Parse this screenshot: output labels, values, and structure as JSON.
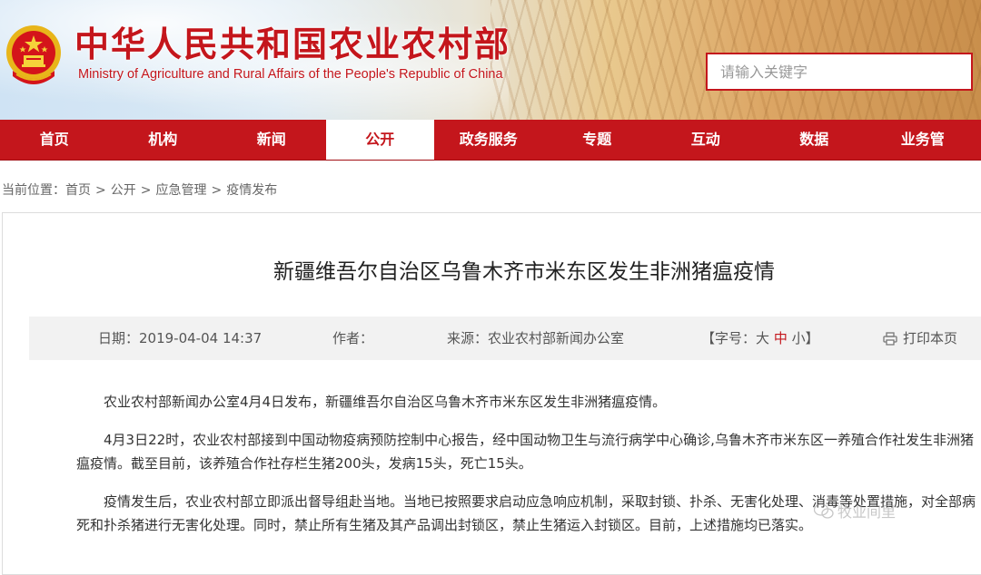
{
  "site": {
    "title": "中华人民共和国农业农村部",
    "subtitle": "Ministry of Agriculture and Rural Affairs of the People's Republic of China"
  },
  "search": {
    "placeholder": "请输入关键字"
  },
  "nav": {
    "items": [
      {
        "label": "首页"
      },
      {
        "label": "机构"
      },
      {
        "label": "新闻"
      },
      {
        "label": "公开"
      },
      {
        "label": "政务服务"
      },
      {
        "label": "专题"
      },
      {
        "label": "互动"
      },
      {
        "label": "数据"
      },
      {
        "label": "业务管"
      }
    ],
    "active_index": 3
  },
  "breadcrumb": {
    "prefix": "当前位置：",
    "items": [
      "首页",
      "公开",
      "应急管理",
      "疫情发布"
    ],
    "separator": ">"
  },
  "article": {
    "title": "新疆维吾尔自治区乌鲁木齐市米东区发生非洲猪瘟疫情",
    "meta": {
      "date": "日期：2019-04-04 14:37",
      "author": "作者：",
      "source": "来源：农业农村部新闻办公室",
      "fontsize_prefix": "【字号：",
      "fontsize_large": "大",
      "fontsize_medium": "中",
      "fontsize_small": "小",
      "fontsize_suffix": "】",
      "print": "打印本页"
    },
    "paragraphs": [
      "农业农村部新闻办公室4月4日发布，新疆维吾尔自治区乌鲁木齐市米东区发生非洲猪瘟疫情。",
      "4月3日22时，农业农村部接到中国动物疫病预防控制中心报告，经中国动物卫生与流行病学中心确诊,乌鲁木齐市米东区一养殖合作社发生非洲猪瘟疫情。截至目前，该养殖合作社存栏生猪200头，发病15头，死亡15头。",
      "疫情发生后，农业农村部立即派出督导组赴当地。当地已按照要求启动应急响应机制，采取封锁、扑杀、无害化处理、消毒等处置措施，对全部病死和扑杀猪进行无害化处理。同时，禁止所有生猪及其产品调出封锁区，禁止生猪运入封锁区。目前，上述措施均已落实。"
    ]
  },
  "watermark": {
    "text": "牧业间里"
  },
  "colors": {
    "brand_red": "#c4161c",
    "nav_bg": "#c4161c",
    "meta_bg": "#f2f2f2"
  }
}
